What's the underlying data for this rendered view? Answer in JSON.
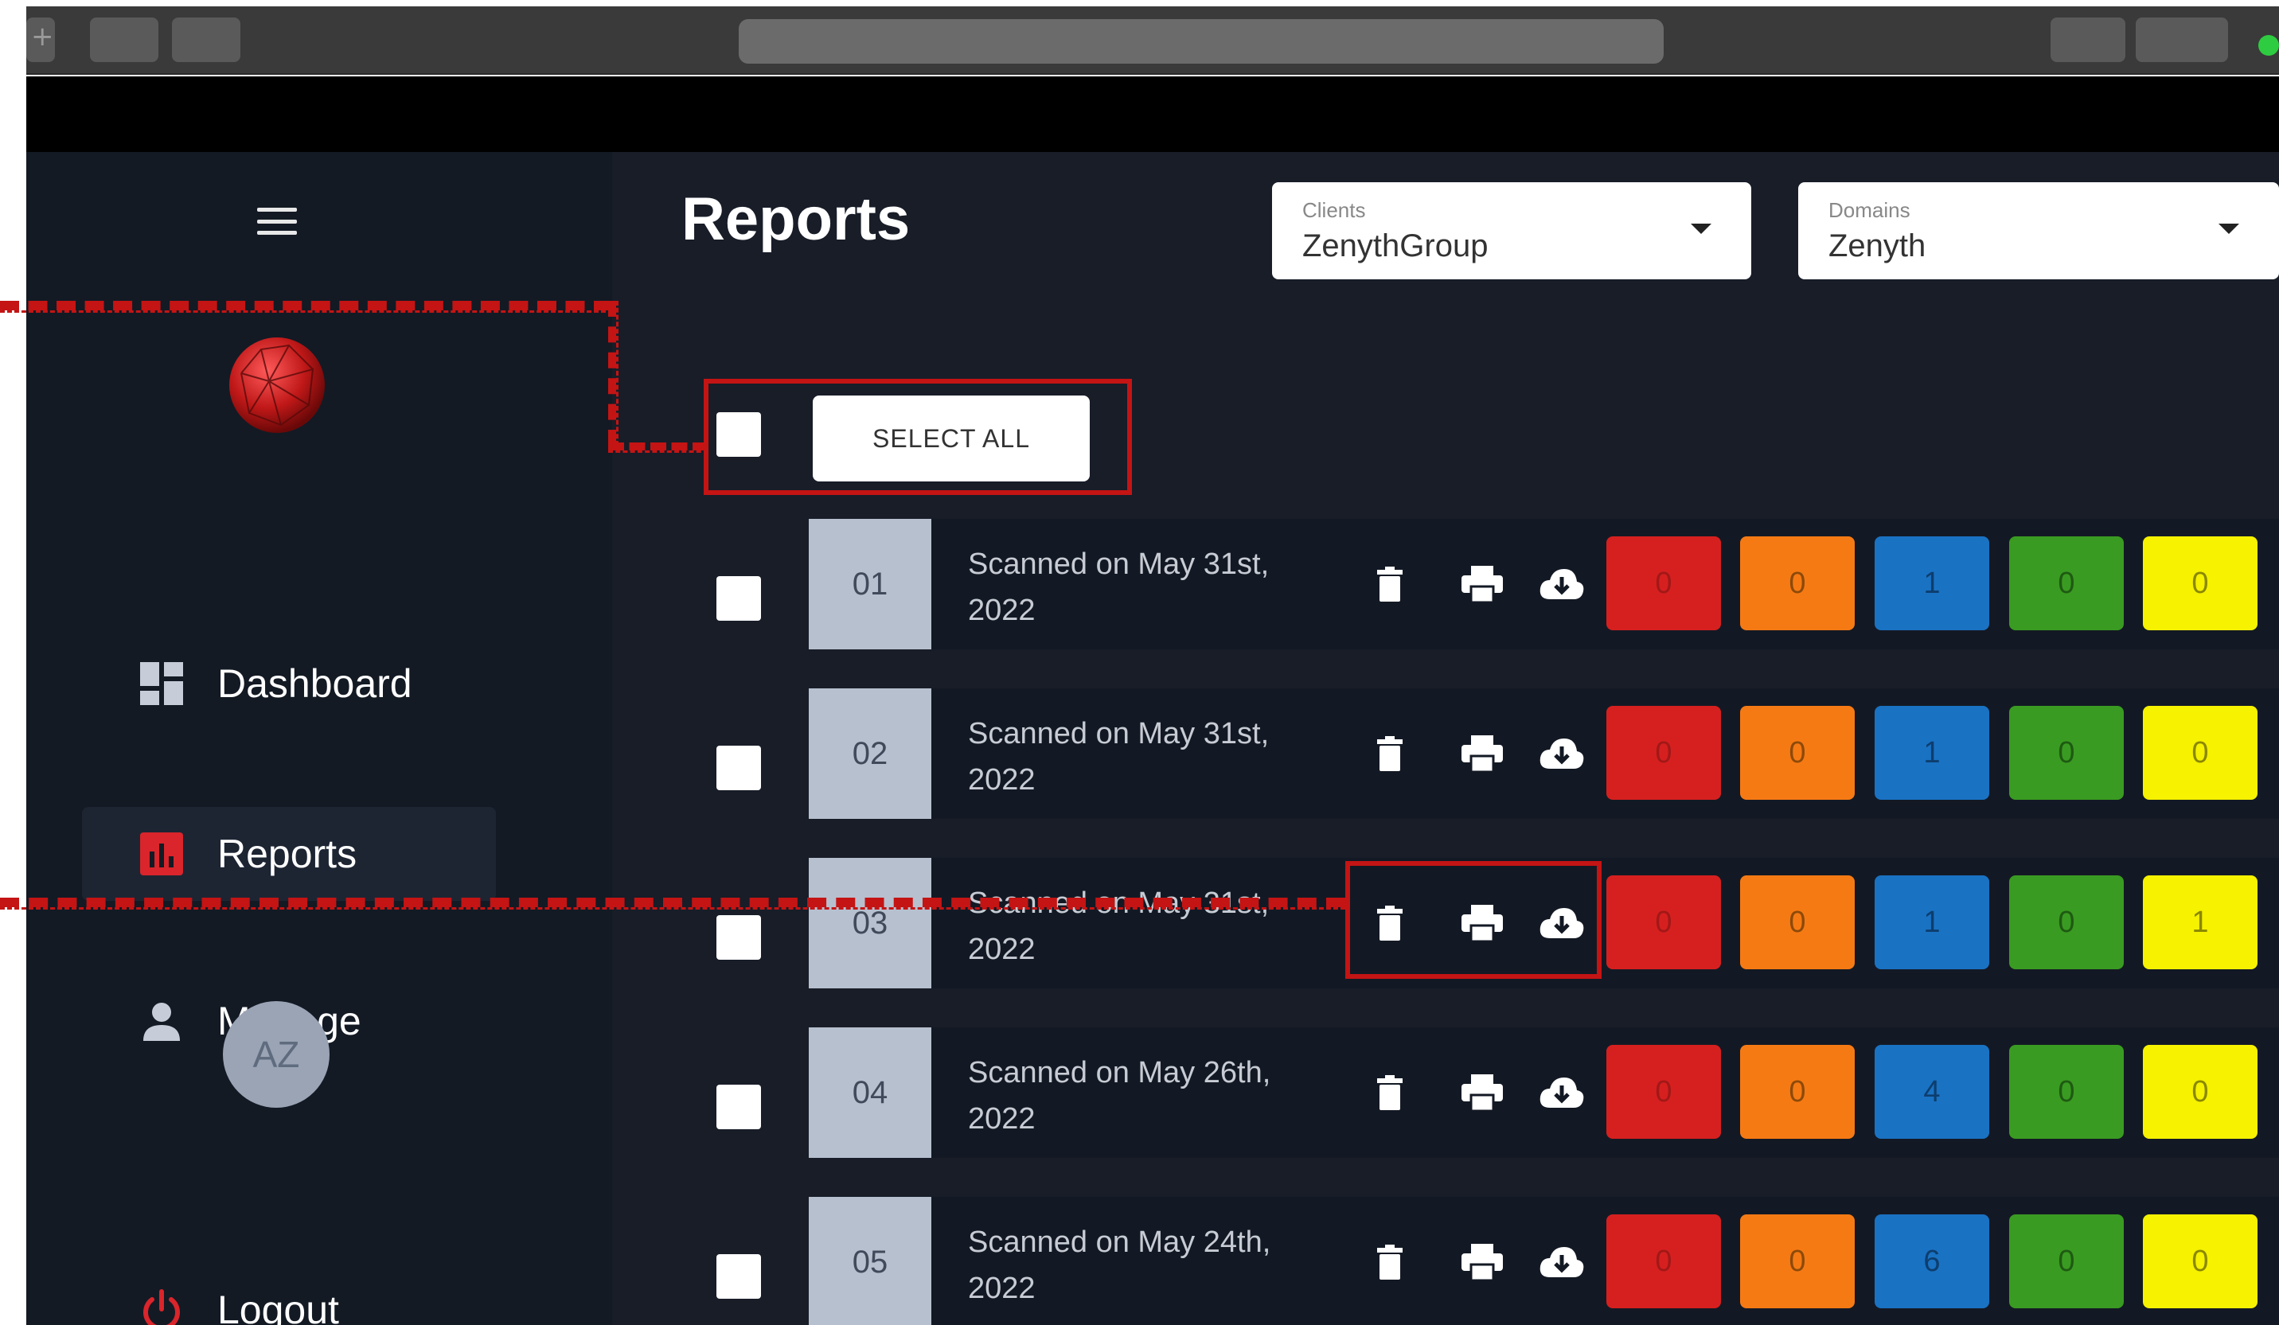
{
  "sidebar": {
    "menu_icon": "hamburger-icon",
    "logo_icon": "red-polyhedron-logo",
    "items": [
      {
        "label": "Dashboard",
        "icon": "dashboard-grid-icon",
        "active": false
      },
      {
        "label": "Reports",
        "icon": "bar-chart-icon",
        "active": true
      },
      {
        "label": "Manage",
        "icon": "person-icon",
        "active": false
      },
      {
        "label": "Logout",
        "icon": "power-icon",
        "active": false
      }
    ],
    "avatar_initials": "AZ"
  },
  "header": {
    "title": "Reports",
    "clients": {
      "label": "Clients",
      "value": "ZenythGroup"
    },
    "domains": {
      "label": "Domains",
      "value": "Zenyth"
    }
  },
  "toolbar": {
    "select_all_label": "SELECT ALL"
  },
  "severity_colors": [
    "#d6201f",
    "#f67a14",
    "#1a72c3",
    "#3a9b22",
    "#f6f200"
  ],
  "reports": [
    {
      "num": "01",
      "line1": "Scanned on May 31st,",
      "line2": "2022",
      "counts": [
        "0",
        "0",
        "1",
        "0",
        "0"
      ]
    },
    {
      "num": "02",
      "line1": "Scanned on May 31st,",
      "line2": "2022",
      "counts": [
        "0",
        "0",
        "1",
        "0",
        "0"
      ]
    },
    {
      "num": "03",
      "line1": "Scanned on May 31st,",
      "line2": "2022",
      "counts": [
        "0",
        "0",
        "1",
        "0",
        "1"
      ]
    },
    {
      "num": "04",
      "line1": "Scanned on May 26th,",
      "line2": "2022",
      "counts": [
        "0",
        "0",
        "4",
        "0",
        "0"
      ]
    },
    {
      "num": "05",
      "line1": "Scanned on May 24th,",
      "line2": "2022",
      "counts": [
        "0",
        "0",
        "6",
        "0",
        "0"
      ]
    }
  ]
}
